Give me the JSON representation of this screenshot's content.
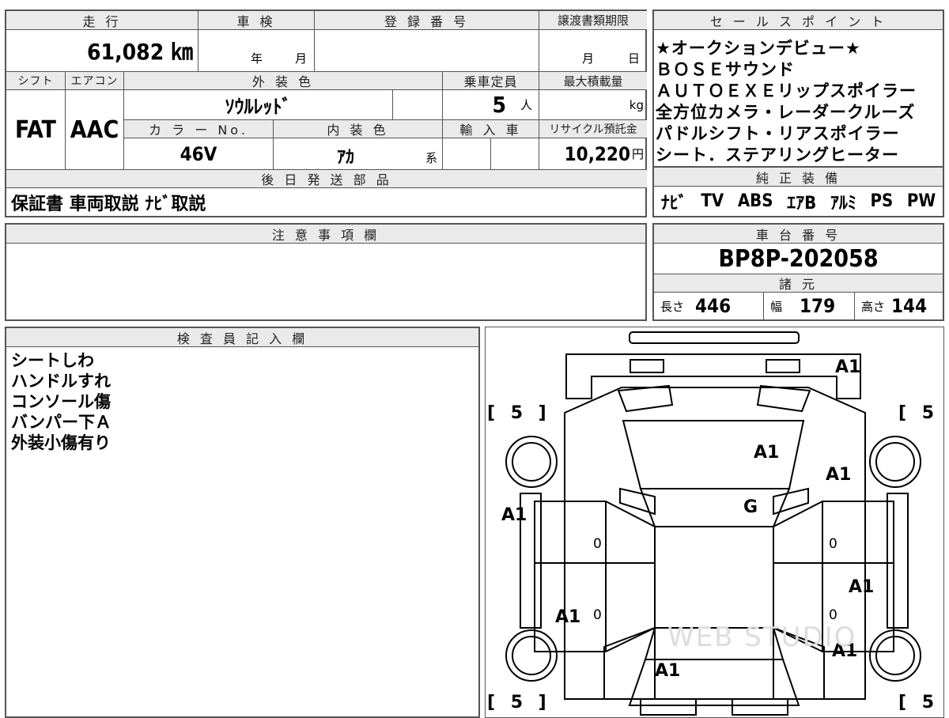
{
  "top_panel": {
    "mileage": {
      "header": "走 行",
      "value": "61,082 ㎞"
    },
    "inspection": {
      "header": "車 検",
      "year_unit": "年",
      "month_unit": "月"
    },
    "registration": {
      "header": "登 録 番 号"
    },
    "transfer_deadline": {
      "header": "譲渡書類期限",
      "month_unit": "月",
      "day_unit": "日"
    },
    "shift": {
      "header": "シフト",
      "value": "FAT"
    },
    "aircon": {
      "header": "エアコン",
      "value": "AAC"
    },
    "exterior_color": {
      "header": "外 装 色",
      "value": "ｿｳﾙﾚｯﾄﾞ"
    },
    "capacity": {
      "header": "乗車定員",
      "value": "5",
      "unit": "人"
    },
    "max_load": {
      "header": "最大積載量",
      "unit": "kg"
    },
    "color_no": {
      "header": "カ ラ ー No.",
      "value": "46V"
    },
    "interior_color": {
      "header": "内 装 色",
      "value": "ｱｶ",
      "suffix": "系"
    },
    "import_car": {
      "header": "輸 入 車"
    },
    "recycle_fee": {
      "header": "リサイクル預託金",
      "value": "10,220",
      "unit": "円"
    },
    "later_parts": {
      "header": "後 日 発 送 部 品",
      "value": "保証書 車両取説 ﾅﾋﾞ取説"
    }
  },
  "sales_points": {
    "header": "セ ー ル ス ポ イ ン ト",
    "lines": [
      "★オークションデビュー★",
      "ＢＯＳＥサウンド",
      "ＡＵＴＯＥＸＥリップスポイラー",
      "全方位カメラ・レーダークルーズ",
      "パドルシフト・リアスポイラー",
      "シート．ステアリングヒーター"
    ]
  },
  "genuine_equipment": {
    "header": "純 正 装 備",
    "items": [
      "ﾅﾋﾞ",
      "TV",
      "ABS",
      "ｴｱB",
      "ｱﾙﾐ",
      "PS",
      "PW"
    ]
  },
  "caution": {
    "header": "注 意 事 項 欄"
  },
  "chassis": {
    "header": "車 台 番 号",
    "value": "BP8P-202058"
  },
  "specs": {
    "header": "諸 元",
    "length_label": "長さ",
    "length": "446",
    "width_label": "幅",
    "width": "179",
    "height_label": "高さ",
    "height": "144"
  },
  "inspector": {
    "header": "検 査 員 記 入 欄",
    "notes": [
      "シートしわ",
      "ハンドルすれ",
      "コンソール傷",
      "バンパー下Ａ",
      "外装小傷有り"
    ]
  },
  "diagram": {
    "tire_marks": [
      "[ 5 ]",
      "[ 5 ]",
      "[ 5 ]",
      "[ 5 ]"
    ],
    "labels": {
      "front_bumper": "A1",
      "hood": "A1",
      "front_right_fender": "A1",
      "windshield": "G",
      "front_left_fender": "A1",
      "rear_right_door": "A1",
      "rear_left_door": "A1",
      "rear_right_quarter": "A1",
      "trunk": "A1",
      "door_zero_1": "0",
      "door_zero_2": "0",
      "door_zero_3": "0",
      "door_zero_4": "0"
    },
    "watermark": "WEB STUDIO"
  }
}
